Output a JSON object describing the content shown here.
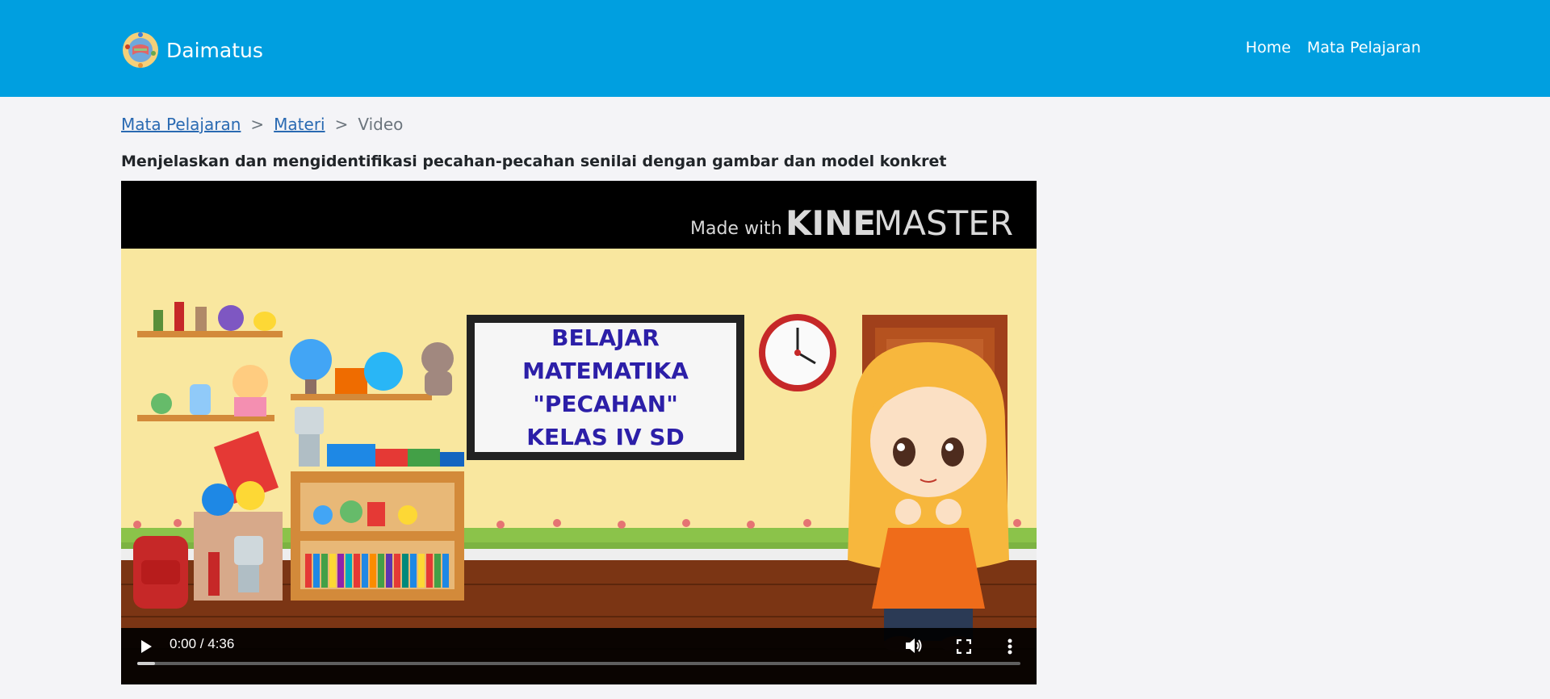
{
  "brand": {
    "name": "Daimatus",
    "logo_icon": "globe-books-logo-icon"
  },
  "nav": {
    "items": [
      {
        "label": "Home"
      },
      {
        "label": "Mata Pelajaran"
      }
    ]
  },
  "breadcrumb": {
    "items": [
      {
        "label": "Mata Pelajaran",
        "link": true
      },
      {
        "label": "Materi",
        "link": true
      },
      {
        "label": "Video",
        "link": false
      }
    ],
    "separator": ">"
  },
  "page": {
    "title": "Menjelaskan dan mengidentifikasi pecahan-pecahan senilai dengan gambar dan model konkret"
  },
  "video": {
    "watermark_prefix": "Made with",
    "watermark_brand_bold": "KINE",
    "watermark_brand_light": "MASTER",
    "board_lines": [
      "BELAJAR",
      "MATEMATIKA",
      "\"PECAHAN\"",
      "KELAS IV SD"
    ],
    "time_display": "0:00 / 4:36",
    "progress": 0.02,
    "controls": {
      "play_icon": "play-icon",
      "volume_icon": "volume-icon",
      "fullscreen_icon": "fullscreen-icon",
      "menu_icon": "more-vert-icon"
    }
  },
  "colors": {
    "navbar": "#009fe0",
    "link": "#2a6ab2",
    "page_bg": "#f4f4f7",
    "board_text": "#2c1fa8"
  }
}
